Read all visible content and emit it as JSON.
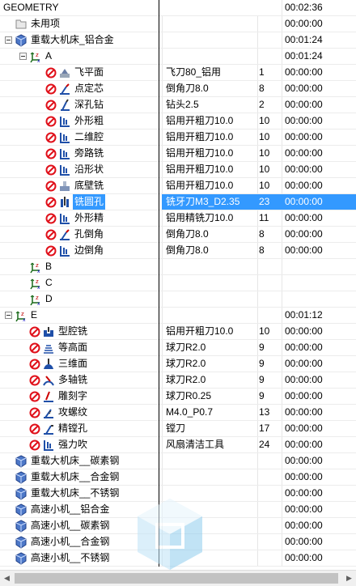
{
  "header": {
    "name": "GEOMETRY",
    "time": "00:02:36"
  },
  "rows": [
    {
      "indent": 0,
      "kind": "folder",
      "name": "未用项",
      "tool": "",
      "num": "",
      "time": "00:00:00"
    },
    {
      "indent": 0,
      "kind": "machine",
      "expander": true,
      "name": "重载大机床_铝合金",
      "tool": "",
      "num": "",
      "time": "00:01:24"
    },
    {
      "indent": 1,
      "kind": "mcs",
      "expander": true,
      "name": "A",
      "tool": "",
      "num": "",
      "time": "00:01:24"
    },
    {
      "indent": 2,
      "kind": "op",
      "icon": "face-mill",
      "name": "飞平面",
      "tool": "飞刀80_铝用",
      "num": "1",
      "time": "00:00:00"
    },
    {
      "indent": 2,
      "kind": "op",
      "icon": "spot-drill",
      "name": "点定芯",
      "tool": "倒角刀8.0",
      "num": "8",
      "time": "00:00:00"
    },
    {
      "indent": 2,
      "kind": "op",
      "icon": "deep-drill",
      "name": "深孔钻",
      "tool": "钻头2.5",
      "num": "2",
      "time": "00:00:00"
    },
    {
      "indent": 2,
      "kind": "op",
      "icon": "planar-mill",
      "name": "外形粗",
      "tool": "铝用开粗刀10.0",
      "num": "10",
      "time": "00:00:00"
    },
    {
      "indent": 2,
      "kind": "op",
      "icon": "planar-mill",
      "name": "二维腔",
      "tool": "铝用开粗刀10.0",
      "num": "10",
      "time": "00:00:00"
    },
    {
      "indent": 2,
      "kind": "op",
      "icon": "planar-mill",
      "name": "旁路铣",
      "tool": "铝用开粗刀10.0",
      "num": "10",
      "time": "00:00:00"
    },
    {
      "indent": 2,
      "kind": "op",
      "icon": "planar-mill",
      "name": "沿形状",
      "tool": "铝用开粗刀10.0",
      "num": "10",
      "time": "00:00:00"
    },
    {
      "indent": 2,
      "kind": "op",
      "icon": "floor-wall",
      "name": "底壁铣",
      "tool": "铝用开粗刀10.0",
      "num": "10",
      "time": "00:00:00"
    },
    {
      "indent": 2,
      "kind": "op",
      "icon": "hole-mill",
      "name": "铣圆孔",
      "tool": "铣牙刀M3_D2.35",
      "num": "23",
      "time": "00:00:00",
      "selected": true
    },
    {
      "indent": 2,
      "kind": "op",
      "icon": "planar-mill",
      "name": "外形精",
      "tool": "铝用精铣刀10.0",
      "num": "11",
      "time": "00:00:00"
    },
    {
      "indent": 2,
      "kind": "op",
      "icon": "spot-drill",
      "name": "孔倒角",
      "tool": "倒角刀8.0",
      "num": "8",
      "time": "00:00:00"
    },
    {
      "indent": 2,
      "kind": "op",
      "icon": "planar-mill",
      "name": "边倒角",
      "tool": "倒角刀8.0",
      "num": "8",
      "time": "00:00:00"
    },
    {
      "indent": 1,
      "kind": "mcs",
      "name": "B",
      "tool": "",
      "num": "",
      "time": ""
    },
    {
      "indent": 1,
      "kind": "mcs",
      "name": "C",
      "tool": "",
      "num": "",
      "time": ""
    },
    {
      "indent": 1,
      "kind": "mcs",
      "name": "D",
      "tool": "",
      "num": "",
      "time": ""
    },
    {
      "indent": 0,
      "kind": "mcs",
      "expander": true,
      "name": "E",
      "tool": "",
      "num": "",
      "time": "00:01:12"
    },
    {
      "indent": 1,
      "kind": "op",
      "icon": "cavity-mill",
      "name": "型腔铣",
      "tool": "铝用开粗刀10.0",
      "num": "10",
      "time": "00:00:00"
    },
    {
      "indent": 1,
      "kind": "op",
      "icon": "zlevel",
      "name": "等高面",
      "tool": "球刀R2.0",
      "num": "9",
      "time": "00:00:00"
    },
    {
      "indent": 1,
      "kind": "op",
      "icon": "contour",
      "name": "三维面",
      "tool": "球刀R2.0",
      "num": "9",
      "time": "00:00:00"
    },
    {
      "indent": 1,
      "kind": "op",
      "icon": "multi-axis",
      "name": "多轴铣",
      "tool": "球刀R2.0",
      "num": "9",
      "time": "00:00:00"
    },
    {
      "indent": 1,
      "kind": "op",
      "icon": "engrave",
      "name": "雕刻字",
      "tool": "球刀R0.25",
      "num": "9",
      "time": "00:00:00"
    },
    {
      "indent": 1,
      "kind": "op",
      "icon": "tap",
      "name": "攻螺纹",
      "tool": "M4.0_P0.7",
      "num": "13",
      "time": "00:00:00"
    },
    {
      "indent": 1,
      "kind": "op",
      "icon": "bore",
      "name": "精镗孔",
      "tool": "镗刀",
      "num": "17",
      "time": "00:00:00"
    },
    {
      "indent": 1,
      "kind": "op",
      "icon": "planar-mill",
      "name": "强力吹",
      "tool": "风扇清洁工具",
      "num": "24",
      "time": "00:00:00"
    },
    {
      "indent": 0,
      "kind": "machine",
      "name": "重载大机床__碳素钢",
      "tool": "",
      "num": "",
      "time": "00:00:00"
    },
    {
      "indent": 0,
      "kind": "machine",
      "name": "重载大机床__合金钢",
      "tool": "",
      "num": "",
      "time": "00:00:00"
    },
    {
      "indent": 0,
      "kind": "machine",
      "name": "重载大机床__不锈钢",
      "tool": "",
      "num": "",
      "time": "00:00:00"
    },
    {
      "indent": 0,
      "kind": "machine",
      "name": "高速小机__铝合金",
      "tool": "",
      "num": "",
      "time": "00:00:00"
    },
    {
      "indent": 0,
      "kind": "machine",
      "name": "高速小机__碳素钢",
      "tool": "",
      "num": "",
      "time": "00:00:00"
    },
    {
      "indent": 0,
      "kind": "machine",
      "name": "高速小机__合金钢",
      "tool": "",
      "num": "",
      "time": "00:00:00"
    },
    {
      "indent": 0,
      "kind": "machine",
      "name": "高速小机__不锈钢",
      "tool": "",
      "num": "",
      "time": "00:00:00"
    }
  ],
  "colors": {
    "selection": "#3399ff",
    "status_red": "#e0101a",
    "icon_blue": "#1f4fa8"
  }
}
